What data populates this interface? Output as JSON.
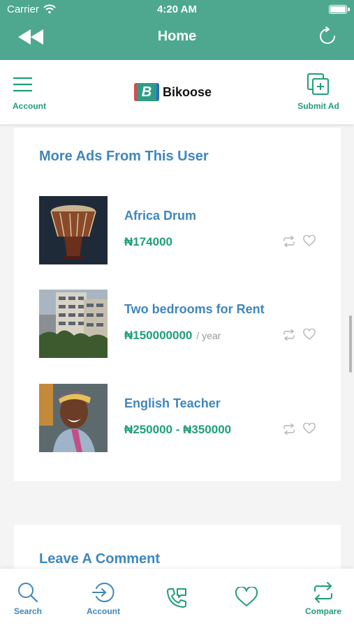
{
  "status_bar": {
    "carrier": "Carrier",
    "time": "4:20 AM"
  },
  "header": {
    "title": "Home",
    "back_icon": "rewind-icon",
    "refresh_icon": "refresh-icon"
  },
  "toolbar": {
    "account_label": "Account",
    "brand_name": "Bikoose",
    "brand_logo_letter": "B",
    "submit_label": "Submit Ad"
  },
  "more_ads": {
    "title": "More Ads From This User",
    "items": [
      {
        "title": "Africa Drum",
        "price": "₦174000",
        "unit": ""
      },
      {
        "title": "Two bedrooms for Rent",
        "price": "₦150000000",
        "unit": "/ year"
      },
      {
        "title": "English Teacher",
        "price": "₦250000 - ₦350000",
        "unit": ""
      }
    ]
  },
  "comment": {
    "title": "Leave A Comment"
  },
  "tabbar": {
    "tabs": [
      {
        "label": "Search",
        "icon": "search-icon"
      },
      {
        "label": "Account",
        "icon": "login-icon"
      },
      {
        "label": "",
        "icon": "phone-chat-icon"
      },
      {
        "label": "",
        "icon": "heart-icon"
      },
      {
        "label": "Compare",
        "icon": "compare-icon"
      }
    ]
  },
  "colors": {
    "header": "#4da88f",
    "brand_green": "#1f9e7a",
    "link_blue": "#3f86bd",
    "background": "#f4f4f4"
  }
}
